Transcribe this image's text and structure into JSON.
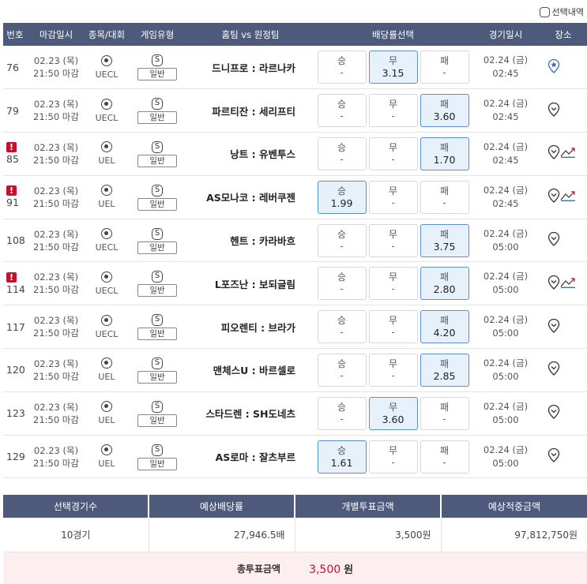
{
  "top": {
    "select_history_label": "선택내역"
  },
  "columns": {
    "no": "번호",
    "deadline": "마감일시",
    "sport": "종목/대회",
    "game_type": "게임유형",
    "teams": "홈팀 vs 원정팀",
    "odds": "배당률선택",
    "game_date": "경기일시",
    "place": "장소"
  },
  "rows": [
    {
      "no": "76",
      "warn": false,
      "d1": "02.23 (목)",
      "d2": "21:50 마감",
      "league": "UECL",
      "badge": "S",
      "gtype": "일반",
      "match": "드니프로 : 라르나카",
      "win": {
        "label": "승",
        "value": "-",
        "selected": false
      },
      "draw": {
        "label": "무",
        "value": "3.15",
        "selected": true
      },
      "loss": {
        "label": "패",
        "value": "-",
        "selected": false
      },
      "g1": "02.24 (금)",
      "g2": "02:45",
      "place_icon": "star-pin-icon",
      "trend": false
    },
    {
      "no": "79",
      "warn": false,
      "d1": "02.23 (목)",
      "d2": "21:50 마감",
      "league": "UECL",
      "badge": "S",
      "gtype": "일반",
      "match": "파르티잔 : 세리프티",
      "win": {
        "label": "승",
        "value": "-",
        "selected": false
      },
      "draw": {
        "label": "무",
        "value": "-",
        "selected": false
      },
      "loss": {
        "label": "패",
        "value": "3.60",
        "selected": true
      },
      "g1": "02.24 (금)",
      "g2": "02:45",
      "place_icon": "pin-icon",
      "trend": false
    },
    {
      "no": "85",
      "warn": true,
      "d1": "02.23 (목)",
      "d2": "21:50 마감",
      "league": "UEL",
      "badge": "S",
      "gtype": "일반",
      "match": "낭트 : 유벤투스",
      "win": {
        "label": "승",
        "value": "-",
        "selected": false
      },
      "draw": {
        "label": "무",
        "value": "-",
        "selected": false
      },
      "loss": {
        "label": "패",
        "value": "1.70",
        "selected": true
      },
      "g1": "02.24 (금)",
      "g2": "02:45",
      "place_icon": "pin-icon",
      "trend": true
    },
    {
      "no": "91",
      "warn": true,
      "d1": "02.23 (목)",
      "d2": "21:50 마감",
      "league": "UEL",
      "badge": "S",
      "gtype": "일반",
      "match": "AS모나코 : 레버쿠젠",
      "win": {
        "label": "승",
        "value": "1.99",
        "selected": true
      },
      "draw": {
        "label": "무",
        "value": "-",
        "selected": false
      },
      "loss": {
        "label": "패",
        "value": "-",
        "selected": false
      },
      "g1": "02.24 (금)",
      "g2": "02:45",
      "place_icon": "pin-icon",
      "trend": true
    },
    {
      "no": "108",
      "warn": false,
      "d1": "02.23 (목)",
      "d2": "21:50 마감",
      "league": "UECL",
      "badge": "S",
      "gtype": "일반",
      "match": "헨트 : 카라바흐",
      "win": {
        "label": "승",
        "value": "-",
        "selected": false
      },
      "draw": {
        "label": "무",
        "value": "-",
        "selected": false
      },
      "loss": {
        "label": "패",
        "value": "3.75",
        "selected": true
      },
      "g1": "02.24 (금)",
      "g2": "05:00",
      "place_icon": "pin-icon",
      "trend": false
    },
    {
      "no": "114",
      "warn": true,
      "d1": "02.23 (목)",
      "d2": "21:50 마감",
      "league": "UECL",
      "badge": "S",
      "gtype": "일반",
      "match": "L포즈난 : 보되글림",
      "win": {
        "label": "승",
        "value": "-",
        "selected": false
      },
      "draw": {
        "label": "무",
        "value": "-",
        "selected": false
      },
      "loss": {
        "label": "패",
        "value": "2.80",
        "selected": true
      },
      "g1": "02.24 (금)",
      "g2": "05:00",
      "place_icon": "pin-icon",
      "trend": true
    },
    {
      "no": "117",
      "warn": false,
      "d1": "02.23 (목)",
      "d2": "21:50 마감",
      "league": "UECL",
      "badge": "S",
      "gtype": "일반",
      "match": "피오렌티 : 브라가",
      "win": {
        "label": "승",
        "value": "-",
        "selected": false
      },
      "draw": {
        "label": "무",
        "value": "-",
        "selected": false
      },
      "loss": {
        "label": "패",
        "value": "4.20",
        "selected": true
      },
      "g1": "02.24 (금)",
      "g2": "05:00",
      "place_icon": "pin-icon",
      "trend": false
    },
    {
      "no": "120",
      "warn": false,
      "d1": "02.23 (목)",
      "d2": "21:50 마감",
      "league": "UEL",
      "badge": "S",
      "gtype": "일반",
      "match": "맨체스U : 바르셀로",
      "win": {
        "label": "승",
        "value": "-",
        "selected": false
      },
      "draw": {
        "label": "무",
        "value": "-",
        "selected": false
      },
      "loss": {
        "label": "패",
        "value": "2.85",
        "selected": true
      },
      "g1": "02.24 (금)",
      "g2": "05:00",
      "place_icon": "pin-icon",
      "trend": false
    },
    {
      "no": "123",
      "warn": false,
      "d1": "02.23 (목)",
      "d2": "21:50 마감",
      "league": "UEL",
      "badge": "S",
      "gtype": "일반",
      "match": "스타드렌 : SH도네츠",
      "win": {
        "label": "승",
        "value": "-",
        "selected": false
      },
      "draw": {
        "label": "무",
        "value": "3.60",
        "selected": true
      },
      "loss": {
        "label": "패",
        "value": "-",
        "selected": false
      },
      "g1": "02.24 (금)",
      "g2": "05:00",
      "place_icon": "pin-icon",
      "trend": false
    },
    {
      "no": "129",
      "warn": false,
      "d1": "02.23 (목)",
      "d2": "21:50 마감",
      "league": "UEL",
      "badge": "S",
      "gtype": "일반",
      "match": "AS로마 : 잘츠부르",
      "win": {
        "label": "승",
        "value": "1.61",
        "selected": true
      },
      "draw": {
        "label": "무",
        "value": "-",
        "selected": false
      },
      "loss": {
        "label": "패",
        "value": "-",
        "selected": false
      },
      "g1": "02.24 (금)",
      "g2": "05:00",
      "place_icon": "pin-icon",
      "trend": false
    }
  ],
  "summary": {
    "headers": [
      "선택경기수",
      "예상배당률",
      "개별투표금액",
      "예상적중금액"
    ],
    "values": [
      "10경기",
      "27,946.5배",
      "3,500원",
      "97,812,750원"
    ]
  },
  "total": {
    "label": "총투표금액",
    "value": "3,500",
    "unit": "원"
  },
  "colors": {
    "header_bg": "#4d5a7c",
    "selected_bg": "#e6f1fb",
    "selected_border": "#5a8fc8",
    "warn": "#c8102e",
    "total_bg": "#fdeef0"
  }
}
